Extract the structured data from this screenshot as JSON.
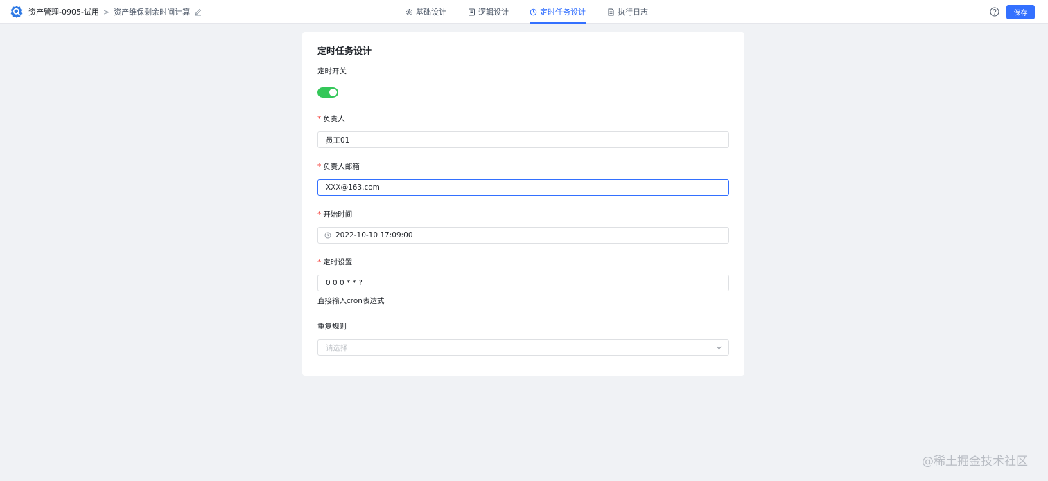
{
  "header": {
    "app_name": "资产管理-0905-试用",
    "separator": ">",
    "flow_name": "资产维保剩余时间计算",
    "tabs": [
      {
        "label": "基础设计",
        "icon": "gear-icon",
        "active": false
      },
      {
        "label": "逻辑设计",
        "icon": "document-icon",
        "active": false
      },
      {
        "label": "定时任务设计",
        "icon": "clock-icon",
        "active": true
      },
      {
        "label": "执行日志",
        "icon": "log-icon",
        "active": false
      }
    ],
    "save_label": "保存"
  },
  "form": {
    "title": "定时任务设计",
    "timer_switch": {
      "label": "定时开关",
      "on": true
    },
    "owner": {
      "label": "负责人",
      "value": "员工01"
    },
    "owner_email": {
      "label": "负责人邮箱",
      "value": "XXX@163.com"
    },
    "start_time": {
      "label": "开始时间",
      "value": "2022-10-10 17:09:00"
    },
    "schedule": {
      "label": "定时设置",
      "value": "0 0 0 * * ?",
      "hint": "直接输入cron表达式"
    },
    "repeat_rule": {
      "label": "重复规则",
      "placeholder": "请选择"
    },
    "required_mark": "*"
  },
  "watermark": "@稀土掘金技术社区",
  "colors": {
    "accent": "#3370ff",
    "switch_on": "#34c759",
    "required": "#f54a45",
    "page_bg": "#f0f2f5"
  }
}
